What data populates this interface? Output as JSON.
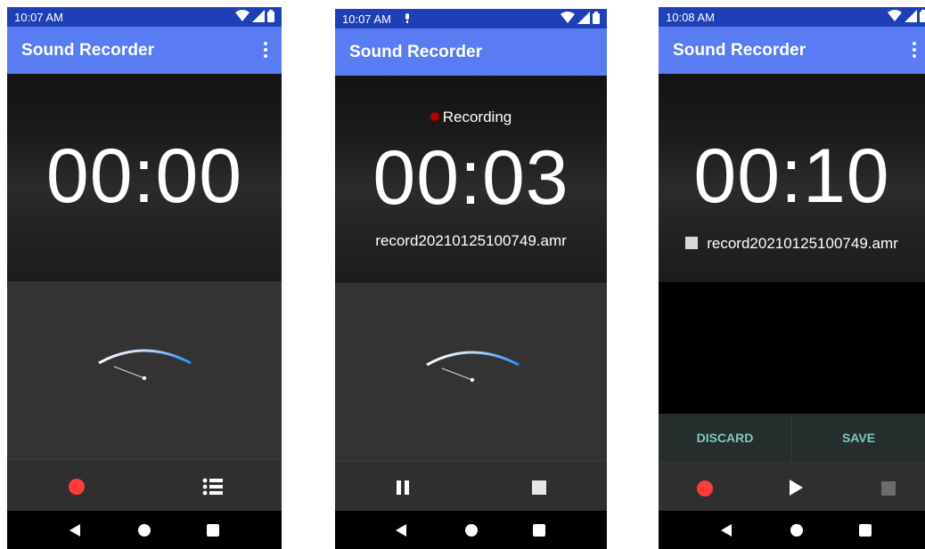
{
  "screens": [
    {
      "status_time": "10:07 AM",
      "app_title": "Sound Recorder",
      "timer": "00:00"
    },
    {
      "status_time": "10:07 AM",
      "app_title": "Sound Recorder",
      "state_label": "Recording",
      "timer": "00:03",
      "file_name": "record20210125100749.amr"
    },
    {
      "status_time": "10:08 AM",
      "app_title": "Sound Recorder",
      "timer": "00:10",
      "file_name": "record20210125100749.amr",
      "discard_label": "DISCARD",
      "save_label": "SAVE"
    }
  ],
  "icons": {
    "overflow": "overflow-menu-icon",
    "record": "record-icon",
    "list": "list-icon",
    "pause": "pause-icon",
    "stop": "stop-icon",
    "play": "play-icon",
    "mic": "mic-icon",
    "wifi": "wifi-icon",
    "signal": "signal-icon",
    "battery": "battery-icon"
  },
  "colors": {
    "app_bar": "#5a7cf3",
    "status_bar": "#1e3fb5",
    "record": "#ff3b3b",
    "recording_dot": "#b30000",
    "action_text": "#7fc9c3"
  }
}
